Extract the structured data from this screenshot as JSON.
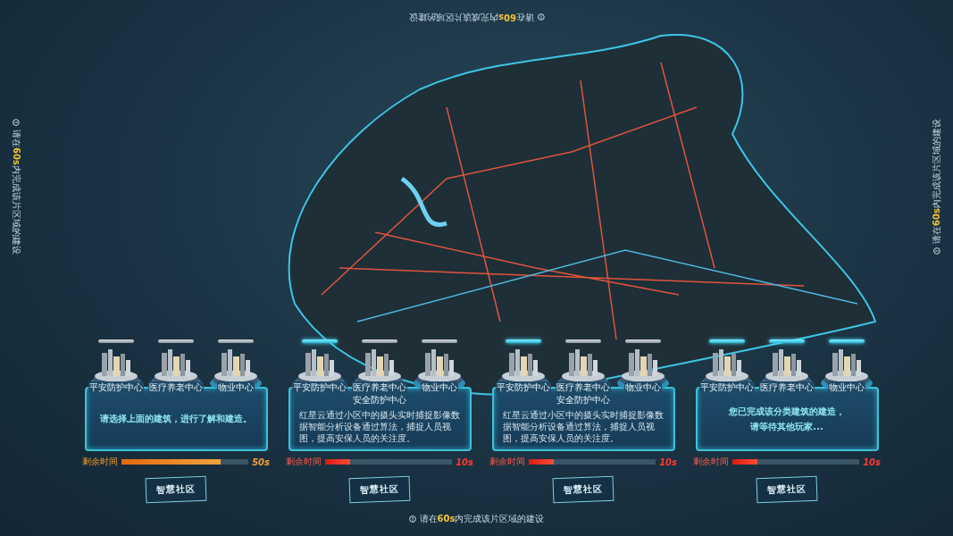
{
  "hint_top": {
    "text": "请在**60s**内完成该片区域的建设"
  },
  "hint_left": {
    "text": "请在**60s**内完成该片区域的建设"
  },
  "hint_right": {
    "text": "请在**60s**内完成该片区域的建设"
  },
  "hint_bottom": {
    "text": "请在**60s**内完成该片区域的建设"
  },
  "panels": [
    {
      "buildings": [
        {
          "label": "平安防护中心",
          "selected": false
        },
        {
          "label": "医疗养老中心",
          "selected": false
        },
        {
          "label": "物业中心",
          "selected": false
        }
      ],
      "kind": "prompt",
      "message": [
        "请选择上面的建筑，进行了解和建造。"
      ],
      "timer": {
        "label": "剩余时间",
        "level": 0.78,
        "reading": "50s",
        "urgent": false
      },
      "button": "智慧社区"
    },
    {
      "buildings": [
        {
          "label": "平安防护中心",
          "selected": true
        },
        {
          "label": "医疗养老中心",
          "selected": false
        },
        {
          "label": "物业中心",
          "selected": false
        }
      ],
      "kind": "info",
      "title": "安全防护中心",
      "body": "红星云通过小区中的摄头实时捕捉影像数据智能分析设备通过算法，捕捉人员视图，提高安保人员的关注度。",
      "timer": {
        "label": "剩余时间",
        "level": 0.2,
        "reading": "10s",
        "urgent": true
      },
      "button": "智慧社区"
    },
    {
      "buildings": [
        {
          "label": "平安防护中心",
          "selected": true
        },
        {
          "label": "医疗养老中心",
          "selected": false
        },
        {
          "label": "物业中心",
          "selected": false
        }
      ],
      "kind": "info",
      "title": "安全防护中心",
      "body": "红星云通过小区中的摄头实时捕捉影像数据智能分析设备通过算法，捕捉人员视图，提高安保人员的关注度。",
      "timer": {
        "label": "剩余时间",
        "level": 0.2,
        "reading": "10s",
        "urgent": true
      },
      "button": "智慧社区"
    },
    {
      "buildings": [
        {
          "label": "平安防护中心",
          "selected": true
        },
        {
          "label": "医疗养老中心",
          "selected": true
        },
        {
          "label": "物业中心",
          "selected": true
        }
      ],
      "kind": "prompt",
      "message": [
        "您已完成该分类建筑的建造，",
        "请等待其他玩家..."
      ],
      "timer": {
        "label": "剩余时间",
        "level": 0.2,
        "reading": "10s",
        "urgent": true
      },
      "button": "智慧社区"
    }
  ]
}
